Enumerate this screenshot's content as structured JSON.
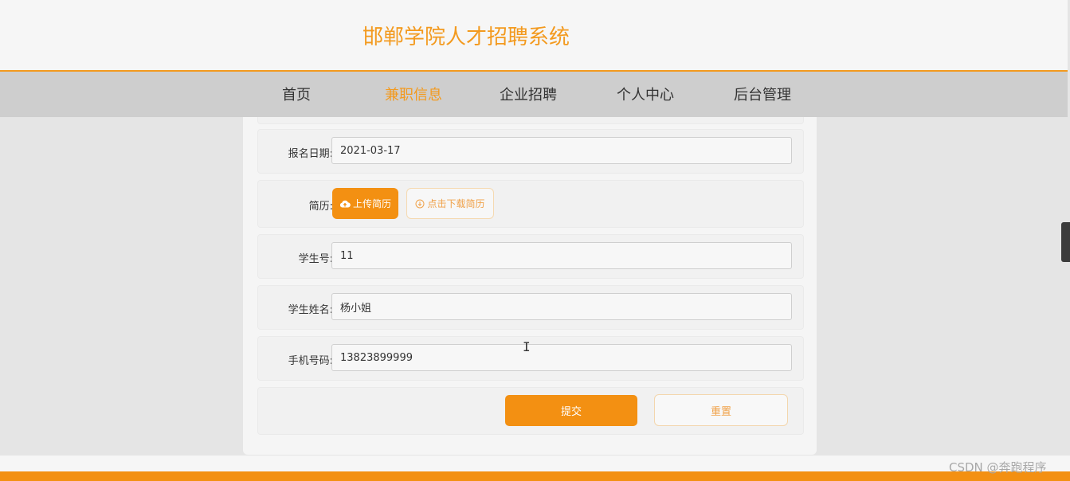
{
  "header": {
    "title": "邯郸学院人才招聘系统"
  },
  "nav": {
    "items": [
      {
        "label": "首页"
      },
      {
        "label": "兼职信息",
        "active": true
      },
      {
        "label": "企业招聘"
      },
      {
        "label": "个人中心"
      },
      {
        "label": "后台管理"
      }
    ]
  },
  "form": {
    "signup_date": {
      "label": "报名日期:",
      "value": "2021-03-17"
    },
    "resume": {
      "label": "简历:",
      "upload_label": "上传简历",
      "download_label": "点击下载简历"
    },
    "student_no": {
      "label": "学生号:",
      "value": "11"
    },
    "student_name": {
      "label": "学生姓名:",
      "value": "杨小姐"
    },
    "phone": {
      "label": "手机号码:",
      "value": "13823899999"
    },
    "submit_label": "提交",
    "reset_label": "重置"
  },
  "watermark": "CSDN @奔跑程序",
  "colors": {
    "accent": "#f39012",
    "nav_bg": "#cecece"
  }
}
